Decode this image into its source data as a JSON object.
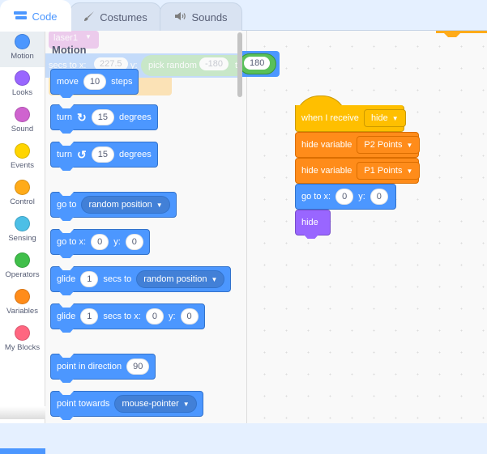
{
  "tabs": [
    {
      "label": "Code",
      "icon": "code-icon",
      "active": true
    },
    {
      "label": "Costumes",
      "icon": "brush-icon",
      "active": false
    },
    {
      "label": "Sounds",
      "icon": "speaker-icon",
      "active": false
    }
  ],
  "categories": [
    {
      "label": "Motion",
      "color": "#4c97ff",
      "selected": true
    },
    {
      "label": "Looks",
      "color": "#9966ff"
    },
    {
      "label": "Sound",
      "color": "#cf63cf"
    },
    {
      "label": "Events",
      "color": "#ffd500"
    },
    {
      "label": "Control",
      "color": "#ffab19"
    },
    {
      "label": "Sensing",
      "color": "#4cbfe6"
    },
    {
      "label": "Operators",
      "color": "#40bf4a"
    },
    {
      "label": "Variables",
      "color": "#ff8c1a"
    },
    {
      "label": "My Blocks",
      "color": "#ff6680"
    }
  ],
  "palette": {
    "section_title": "Motion",
    "blocks": {
      "move": {
        "pre": "move",
        "value": "10",
        "post": "steps"
      },
      "turn_right": {
        "pre": "turn",
        "value": "15",
        "post": "degrees"
      },
      "turn_left": {
        "pre": "turn",
        "value": "15",
        "post": "degrees"
      },
      "go_to": {
        "pre": "go to",
        "dropdown": "random position"
      },
      "go_to_xy": {
        "pre": "go to x:",
        "x": "0",
        "ylabel": "y:",
        "y": "0"
      },
      "glide_to": {
        "pre": "glide",
        "value": "1",
        "mid": "secs to",
        "dropdown": "random position"
      },
      "glide_xy": {
        "pre": "glide",
        "value": "1",
        "mid": "secs to x:",
        "x": "0",
        "ylabel": "y:",
        "y": "0"
      },
      "point_direction": {
        "pre": "point in direction",
        "value": "90"
      },
      "point_towards": {
        "pre": "point towards",
        "dropdown": "mouse-pointer"
      }
    }
  },
  "dragged_ghost": {
    "sprite_dropdown": "laser1",
    "secs_to_x": "secs to x:",
    "x_value": "227.5",
    "y_label": "y:",
    "pick_random": "pick random",
    "from": "-180",
    "to_label": "to",
    "to_value": "180"
  },
  "script": {
    "hat": {
      "label": "when I receive",
      "message": "hide"
    },
    "hide_var_1": {
      "label": "hide variable",
      "variable": "P2 Points"
    },
    "hide_var_2": {
      "label": "hide variable",
      "variable": "P1 Points"
    },
    "goto": {
      "label": "go to x:",
      "x": "0",
      "ylabel": "y:",
      "y": "0"
    },
    "hide": {
      "label": "hide"
    }
  }
}
